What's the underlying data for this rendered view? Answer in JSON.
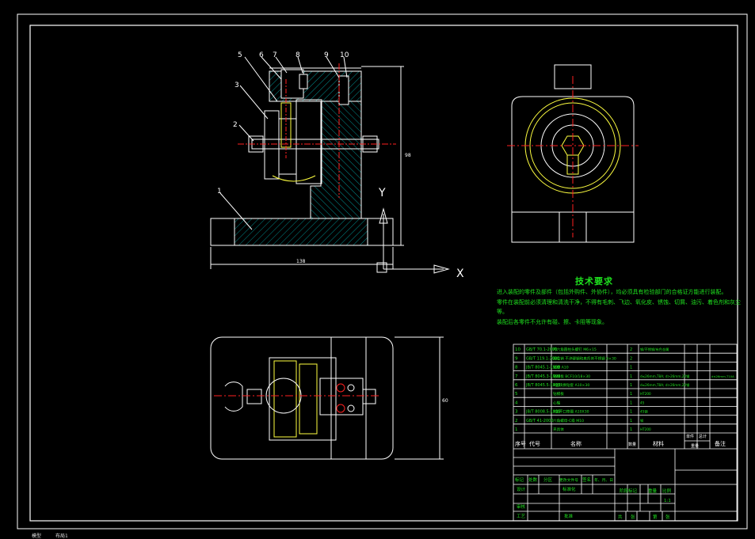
{
  "colors": {
    "outline": "#ffffff",
    "hatch": "#00c8c8",
    "center": "#ff2020",
    "part": "#ffff40",
    "table_text": "#20e020",
    "frame": "#ffffff"
  },
  "front_view": {
    "balloons": [
      "1",
      "2",
      "3",
      "5",
      "6",
      "7",
      "8",
      "9",
      "10"
    ],
    "dim_width": "138",
    "dim_height": "98"
  },
  "axis": {
    "y_label": "Y",
    "x_label": "X"
  },
  "tech": {
    "title": "技术要求",
    "lines": [
      "进入装配的零件及部件（包括外购件、外协件），均必须具有检验部门的合格证方能进行装配。",
      "零件在装配前必须清理和清洗干净，不得有毛刺、飞边、氧化皮、锈蚀、切屑、油污、着色剂和灰尘",
      "等。",
      "装配后各零件不允许有碰、擦、卡阻等现象。"
    ]
  },
  "top_view": {
    "dim_height": "60"
  },
  "bom": {
    "rows": [
      {
        "no": "10",
        "code": "GB/T 70.1-2000",
        "name": "内六角圆柱头螺钉 M6×15",
        "qty": "2",
        "mat": "钢/不锈钢/有色金属",
        "note": ""
      },
      {
        "no": "9",
        "code": "GB/T 119.1-2000",
        "name": "圆柱销 不淬硬钢和奥氏体不锈钢 6×30",
        "qty": "2",
        "mat": "",
        "note": ""
      },
      {
        "no": "8",
        "code": "JB/T 8045.1-1999",
        "name": "钻套 A10",
        "qty": "1",
        "mat": "",
        "note": ""
      },
      {
        "no": "7",
        "code": "JB/T 8045.3-1999",
        "name": "钻模板 BCF10/18×30",
        "qty": "1",
        "mat": "d≤26mm,T8A; d>26mm,20钢",
        "note": "d≤26mm,T10A"
      },
      {
        "no": "6",
        "code": "JB/T 8045.5-1999",
        "name": "A型快换钻套 A10×30",
        "qty": "1",
        "mat": "d≤26mm,T8A; d>26mm,20钢",
        "note": ""
      },
      {
        "no": "5",
        "code": "",
        "name": "钻模板",
        "qty": "1",
        "mat": "HT200",
        "note": ""
      },
      {
        "no": "4",
        "code": "",
        "name": "心轴",
        "qty": "1",
        "mat": "45",
        "note": ""
      },
      {
        "no": "3",
        "code": "JB/T 8008.5-1999",
        "name": "A型开口垫圈 A10X30",
        "qty": "1",
        "mat": "45钢",
        "note": ""
      },
      {
        "no": "2",
        "code": "GB/T 41-2000",
        "name": "六角螺母-C级 M10",
        "qty": "1",
        "mat": "钢",
        "note": ""
      },
      {
        "no": "1",
        "code": "",
        "name": "夹具体",
        "qty": "1",
        "mat": "HT200",
        "note": ""
      }
    ],
    "header": {
      "no": "序号",
      "code": "代号",
      "name": "名称",
      "qty": "数量",
      "mat": "材料",
      "unit": "单件",
      "total": "总计",
      "weight": "重量",
      "note": "备注"
    },
    "title_block": {
      "mark": "标记",
      "count": "处数",
      "zone": "分区",
      "change": "更改文件号",
      "sign": "签名",
      "date": "年、月、日",
      "design": "设计",
      "std": "标准化",
      "stage": "阶段标记",
      "weight": "重量",
      "ratio": "比例",
      "scale": "1:1",
      "review": "审核",
      "craft": "工艺",
      "approve": "批准",
      "sheet1": "共",
      "sheet2": "张",
      "sheet3": "第",
      "sheet4": "张"
    }
  },
  "status": {
    "left": "模型",
    "tab": "布局1"
  }
}
